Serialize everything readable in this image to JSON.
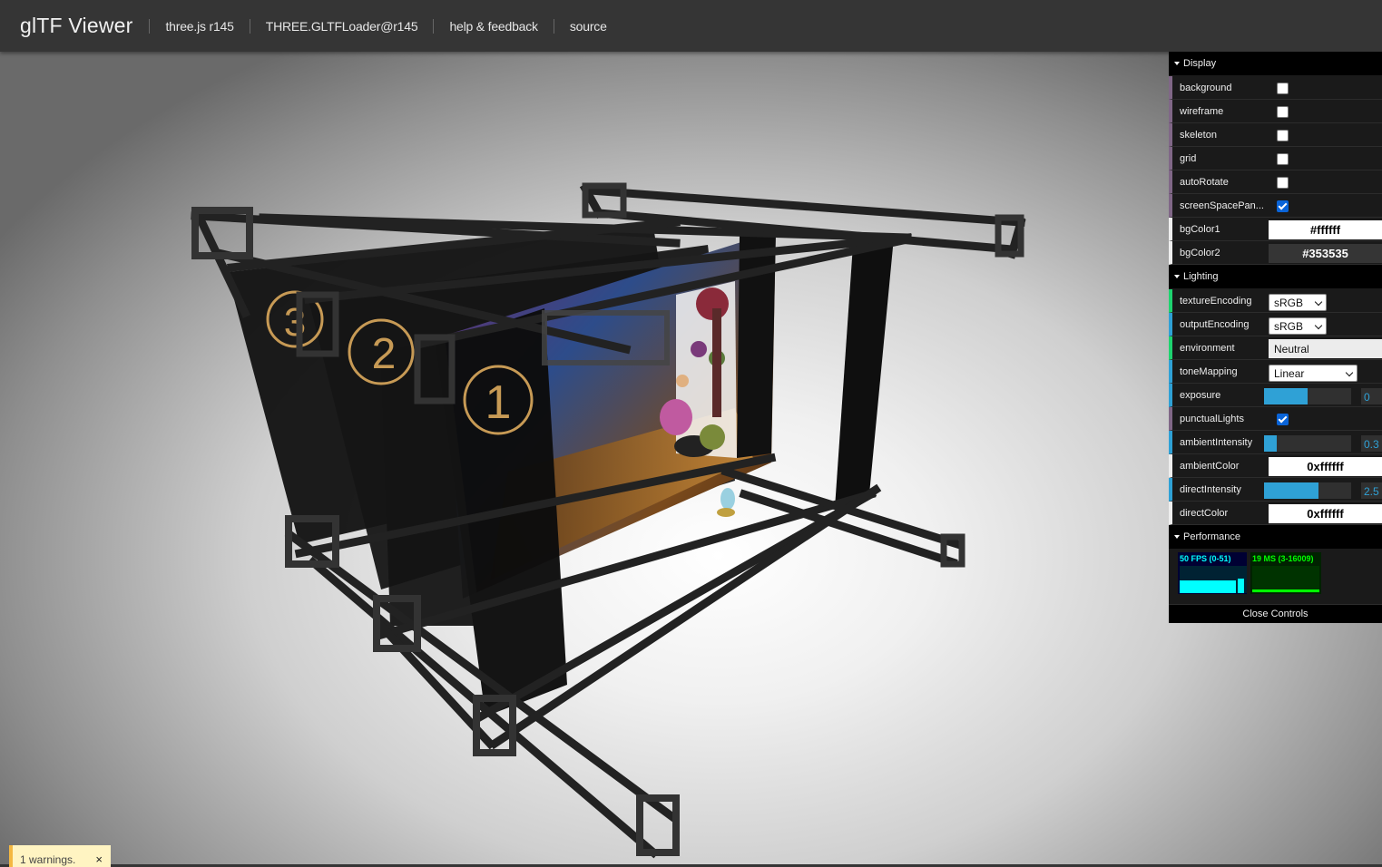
{
  "header": {
    "title": "glTF Viewer",
    "links": [
      "three.js r145",
      "THREE.GLTFLoader@r145",
      "help & feedback",
      "source"
    ]
  },
  "scene": {
    "panel_numbers": [
      "3",
      "2",
      "1"
    ]
  },
  "warnings": {
    "text": "1 warnings.",
    "close": "×"
  },
  "gui": {
    "display": {
      "title": "Display",
      "background": "background",
      "background_checked": false,
      "wireframe": "wireframe",
      "wireframe_checked": false,
      "skeleton": "skeleton",
      "skeleton_checked": false,
      "grid": "grid",
      "grid_checked": false,
      "autoRotate": "autoRotate",
      "autoRotate_checked": false,
      "screenSpacePan": "screenSpacePan...",
      "screenSpacePan_checked": true,
      "bgColor1": "bgColor1",
      "bgColor1_value": "#ffffff",
      "bgColor2": "bgColor2",
      "bgColor2_value": "#353535"
    },
    "lighting": {
      "title": "Lighting",
      "textureEncoding": "textureEncoding",
      "textureEncoding_value": "sRGB",
      "outputEncoding": "outputEncoding",
      "outputEncoding_value": "sRGB",
      "environment": "environment",
      "environment_value": "Neutral",
      "toneMapping": "toneMapping",
      "toneMapping_value": "Linear",
      "exposure": "exposure",
      "exposure_value": "0",
      "exposure_fill": 0.5,
      "punctualLights": "punctualLights",
      "punctualLights_checked": true,
      "ambientIntensity": "ambientIntensity",
      "ambientIntensity_value": "0.3",
      "ambientIntensity_fill": 0.15,
      "ambientColor": "ambientColor",
      "ambientColor_value": "0xffffff",
      "directIntensity": "directIntensity",
      "directIntensity_value": "2.5",
      "directIntensity_fill": 0.625,
      "directColor": "directColor",
      "directColor_value": "0xffffff"
    },
    "performance": {
      "title": "Performance",
      "fps_text": "50 FPS (0-51)",
      "ms_text": "19 MS (3-16009)"
    },
    "close_label": "Close Controls"
  },
  "colors": {
    "header_bg": "#353535",
    "accent_blue": "#2fa1d6",
    "accent_green": "#1ed36f",
    "accent_purple": "#806787"
  }
}
